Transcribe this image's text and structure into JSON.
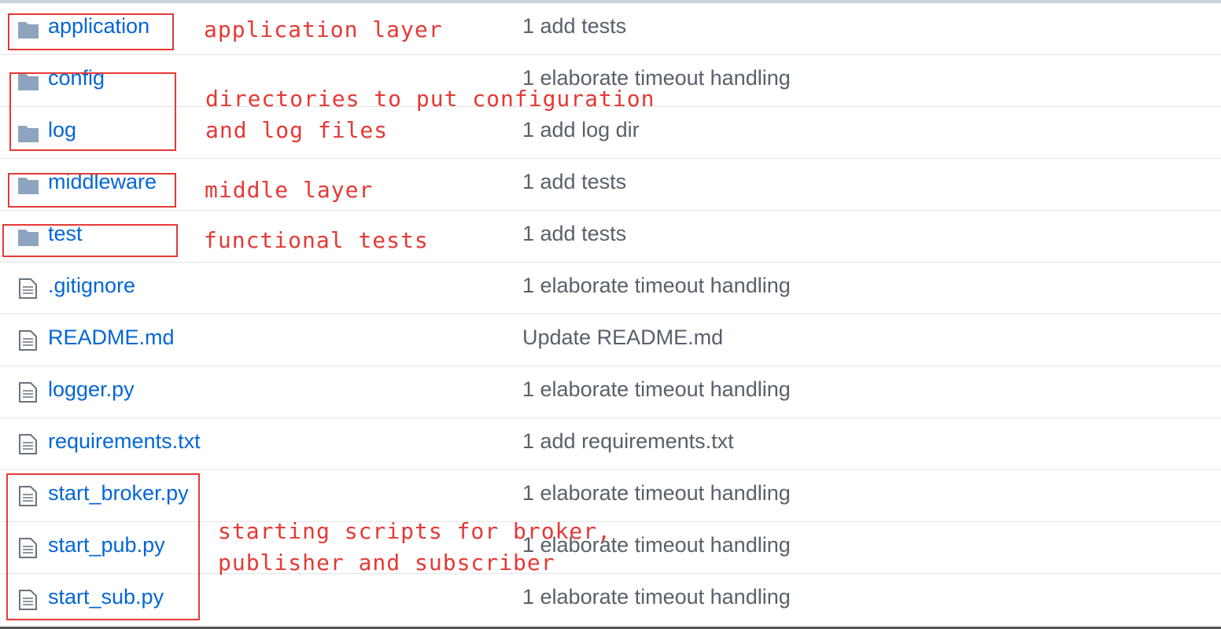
{
  "entries": [
    {
      "type": "dir",
      "icon": "folder-icon",
      "name": "application",
      "message": "1 add tests"
    },
    {
      "type": "dir",
      "icon": "folder-icon",
      "name": "config",
      "message": "1 elaborate timeout handling"
    },
    {
      "type": "dir",
      "icon": "folder-icon",
      "name": "log",
      "message": "1 add log dir"
    },
    {
      "type": "dir",
      "icon": "folder-icon",
      "name": "middleware",
      "message": "1 add tests"
    },
    {
      "type": "dir",
      "icon": "folder-icon",
      "name": "test",
      "message": "1 add tests"
    },
    {
      "type": "file",
      "icon": "file-icon",
      "name": ".gitignore",
      "message": "1 elaborate timeout handling"
    },
    {
      "type": "file",
      "icon": "file-icon",
      "name": "README.md",
      "message": "Update README.md"
    },
    {
      "type": "file",
      "icon": "file-icon",
      "name": "logger.py",
      "message": "1 elaborate timeout handling"
    },
    {
      "type": "file",
      "icon": "file-icon",
      "name": "requirements.txt",
      "message": "1 add requirements.txt"
    },
    {
      "type": "file",
      "icon": "file-icon",
      "name": "start_broker.py",
      "message": "1 elaborate timeout handling"
    },
    {
      "type": "file",
      "icon": "file-icon",
      "name": "start_pub.py",
      "message": "1 elaborate timeout handling"
    },
    {
      "type": "file",
      "icon": "file-icon",
      "name": "start_sub.py",
      "message": "1 elaborate timeout handling"
    }
  ],
  "annotations": {
    "application": "application layer",
    "config_log": "directories to put configuration\nand log files",
    "middleware": "middle layer",
    "test": "functional tests",
    "scripts": "starting scripts for broker,\npublisher and subscriber"
  },
  "colors": {
    "link": "#0366d6",
    "message": "#586069",
    "folder": "#79b8ff",
    "annotation": "#e53935"
  }
}
